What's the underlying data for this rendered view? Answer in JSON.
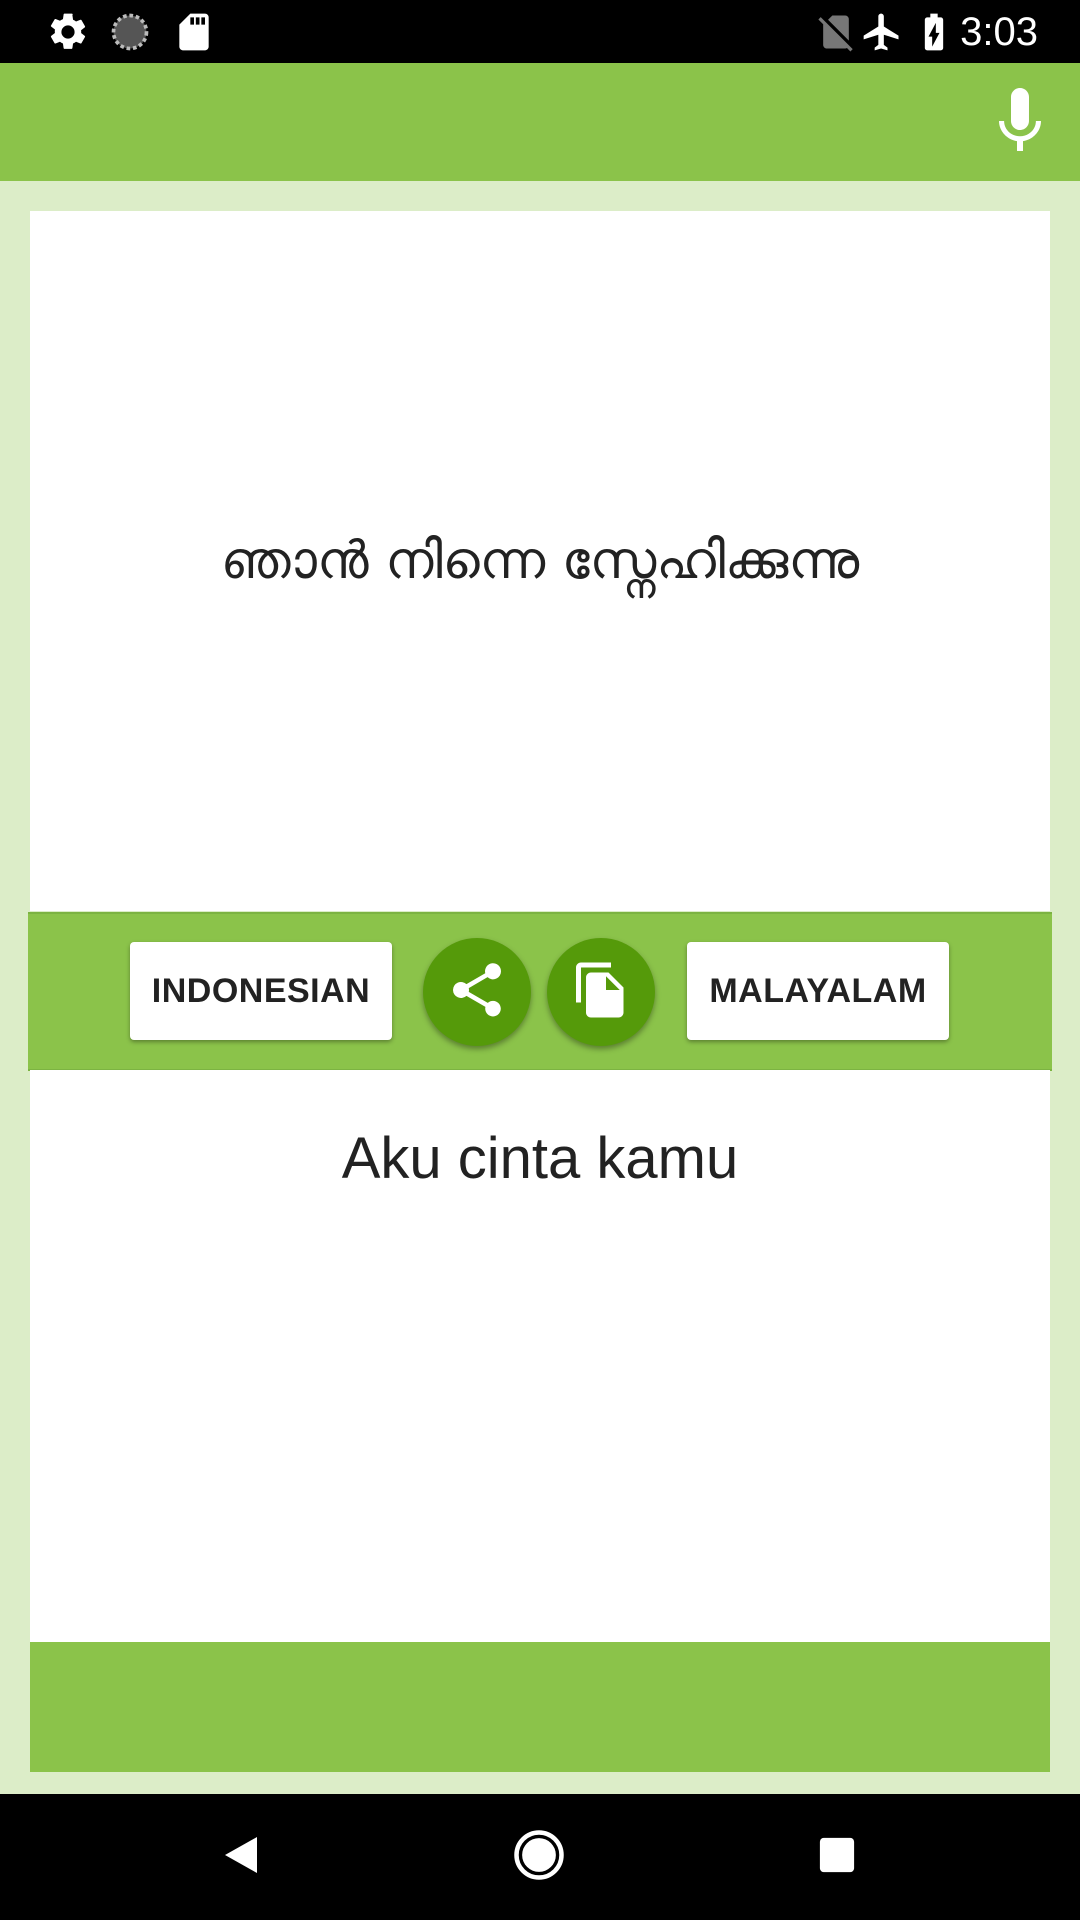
{
  "status_bar": {
    "time": "3:03",
    "left_icons": [
      "settings-icon",
      "sync-circle-icon",
      "sd-card-icon"
    ],
    "right_icons": [
      "no-sim-icon",
      "airplane-mode-icon",
      "battery-charging-icon"
    ]
  },
  "app_bar": {
    "action_icon": "microphone-icon"
  },
  "translation": {
    "source_text": "ഞാൻ നിന്നെ സ്നേഹിക്കുന്നു",
    "target_text": "Aku cinta kamu"
  },
  "language_bar": {
    "from_language": "INDONESIAN",
    "to_language": "MALAYALAM",
    "share_icon": "share-icon",
    "copy_icon": "copy-icon"
  },
  "nav_bar": {
    "icons": [
      "back-icon",
      "home-icon",
      "recents-icon"
    ]
  },
  "colors": {
    "primary": "#8bc34a",
    "primary_dark": "#559a0a",
    "background": "#dcedc8"
  }
}
